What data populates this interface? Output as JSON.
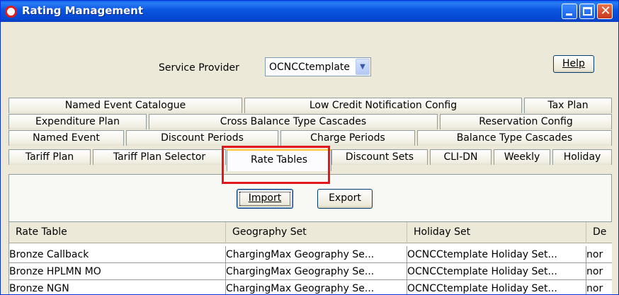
{
  "window": {
    "title": "Rating Management"
  },
  "service_provider": {
    "label": "Service Provider",
    "value": "OCNCCtemplate"
  },
  "buttons": {
    "help": "Help",
    "import": "Import",
    "export": "Export"
  },
  "tabs": {
    "row1": [
      "Named Event Catalogue",
      "Low Credit Notification Config",
      "Tax Plan"
    ],
    "row2": [
      "Expenditure Plan",
      "Cross Balance Type Cascades",
      "Reservation Config"
    ],
    "row3": [
      "Named Event",
      "Discount Periods",
      "Charge Periods",
      "Balance Type Cascades"
    ],
    "row4": [
      "Tariff Plan",
      "Tariff Plan Selector",
      "Rate Tables",
      "Discount Sets",
      "CLI-DN",
      "Weekly",
      "Holiday"
    ],
    "selected": "Rate Tables"
  },
  "table": {
    "columns": [
      "Rate Table",
      "Geography Set",
      "Holiday Set",
      "De"
    ],
    "rows": [
      [
        "Bronze Callback",
        "ChargingMax Geography Se...",
        "OCNCCtemplate Holiday Set...",
        "nor"
      ],
      [
        "Bronze HPLMN MO",
        "ChargingMax Geography Se...",
        "OCNCCtemplate Holiday Set...",
        "nor"
      ],
      [
        "Bronze NGN",
        "ChargingMax Geography Se...",
        "OCNCCtemplate Holiday Set...",
        "nor"
      ]
    ]
  },
  "colors": {
    "titlebar": "#0548d2",
    "highlight_box": "#e3161c",
    "selected_tab_accent": "#ffc83c"
  }
}
